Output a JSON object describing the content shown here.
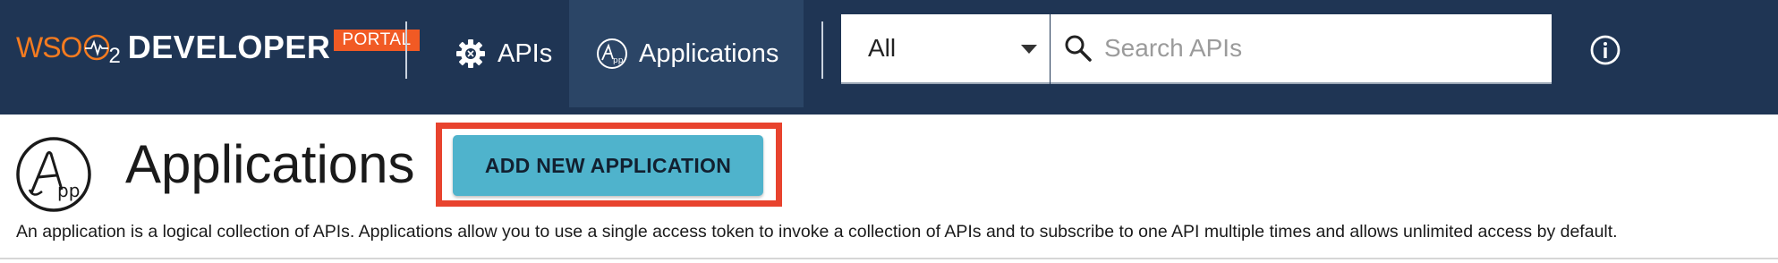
{
  "brand": {
    "wso": "WSO",
    "two": "2",
    "developer": "DEVELOPER",
    "portal": "PORTAL",
    "orange": "#f47b20",
    "portal_bg": "#f15a24"
  },
  "nav": {
    "items": [
      {
        "label": "APIs",
        "icon": "gear-icon",
        "active": false
      },
      {
        "label": "Applications",
        "icon": "app-icon",
        "active": true
      }
    ],
    "bar_color": "#1f3554",
    "active_color": "#2b4566"
  },
  "search": {
    "filter_value": "All",
    "placeholder": "Search APIs",
    "value": ""
  },
  "info": {
    "icon": "info-icon"
  },
  "page": {
    "title": "Applications",
    "add_button_label": "ADD NEW APPLICATION",
    "description": "An application is a logical collection of APIs. Applications allow you to use a single access token to invoke a collection of APIs and to subscribe to one API multiple times and allows unlimited access by default.",
    "button_color": "#4fb3cc",
    "highlight_color": "#e8432e",
    "app_logo_icon": "app-logo-icon"
  }
}
